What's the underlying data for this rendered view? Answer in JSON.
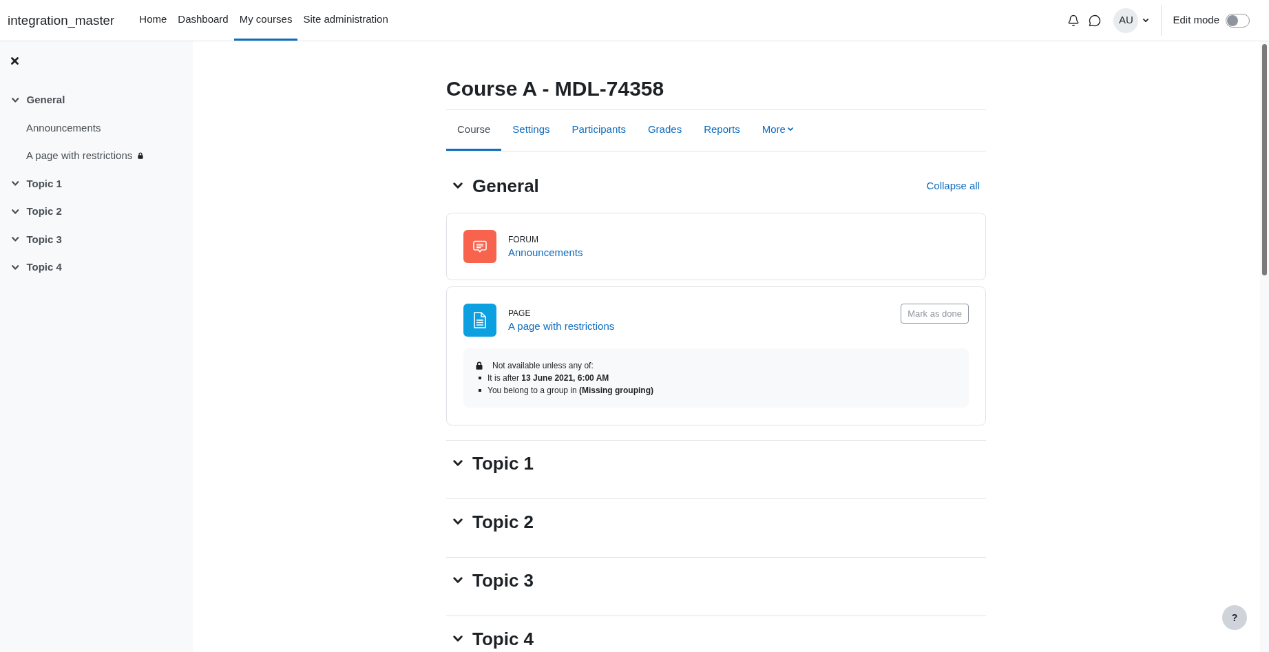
{
  "navbar": {
    "brand": "integration_master",
    "links": [
      {
        "label": "Home",
        "selected": false
      },
      {
        "label": "Dashboard",
        "selected": false
      },
      {
        "label": "My courses",
        "selected": true
      },
      {
        "label": "Site administration",
        "selected": false
      }
    ],
    "user_initials": "AU",
    "edit_mode": {
      "label": "Edit mode",
      "on": false
    }
  },
  "course_index": {
    "sections": [
      {
        "title": "General",
        "expanded": true,
        "children": [
          {
            "label": "Announcements",
            "locked": false
          },
          {
            "label": "A page with restrictions",
            "locked": true
          }
        ]
      },
      {
        "title": "Topic 1",
        "expanded": true
      },
      {
        "title": "Topic 2",
        "expanded": true
      },
      {
        "title": "Topic 3",
        "expanded": true
      },
      {
        "title": "Topic 4",
        "expanded": true
      }
    ]
  },
  "course": {
    "title": "Course A - MDL-74358",
    "tabs": [
      {
        "label": "Course",
        "kind": "link",
        "selected": true
      },
      {
        "label": "Settings",
        "kind": "link",
        "selected": false
      },
      {
        "label": "Participants",
        "kind": "link",
        "selected": false
      },
      {
        "label": "Grades",
        "kind": "link",
        "selected": false
      },
      {
        "label": "Reports",
        "kind": "link",
        "selected": false
      },
      {
        "label": "More",
        "kind": "menu",
        "selected": false
      }
    ],
    "collapse_all": "Collapse all",
    "sections": [
      {
        "title": "General",
        "expanded": true,
        "activities": [
          {
            "kind": "forum",
            "type": "FORUM",
            "name": "Announcements"
          },
          {
            "kind": "page",
            "type": "PAGE",
            "name": "A page with restrictions",
            "completion_button": "Mark as done",
            "restriction": {
              "heading": "Not available unless any of:",
              "conditions": [
                "It is after **13 June 2021, 6:00 AM**",
                "You belong to a group in **(Missing grouping)**"
              ]
            }
          }
        ]
      },
      {
        "title": "Topic 1",
        "expanded": true
      },
      {
        "title": "Topic 2",
        "expanded": true
      },
      {
        "title": "Topic 3",
        "expanded": true
      },
      {
        "title": "Topic 4",
        "expanded": true
      }
    ]
  },
  "help_button": "?"
}
